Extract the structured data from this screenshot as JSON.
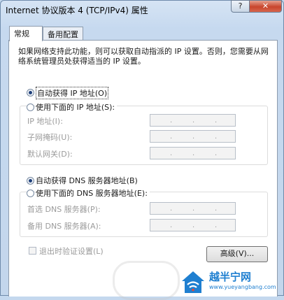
{
  "window": {
    "title": "Internet 协议版本 4 (TCP/IPv4) 属性",
    "help_label": "?",
    "close_label": "✕"
  },
  "tabs": [
    {
      "label": "常规",
      "active": true
    },
    {
      "label": "备用配置",
      "active": false
    }
  ],
  "description": "如果网络支持此功能，则可以获取自动指派的 IP 设置。否则，您需要从网络系统管理员处获得适当的 IP 设置。",
  "ip_section": {
    "auto_option": {
      "label": "自动获得 IP 地址(O)",
      "checked": true
    },
    "manual_option": {
      "label": "使用下面的 IP 地址(S):",
      "checked": false
    },
    "fields": [
      {
        "label": "IP 地址(I):",
        "value": ". . ."
      },
      {
        "label": "子网掩码(U):",
        "value": ". . ."
      },
      {
        "label": "默认网关(D):",
        "value": ". . ."
      }
    ]
  },
  "dns_section": {
    "auto_option": {
      "label": "自动获得 DNS 服务器地址(B)",
      "checked": true
    },
    "manual_option": {
      "label": "使用下面的 DNS 服务器地址(E):",
      "checked": false
    },
    "fields": [
      {
        "label": "首选 DNS 服务器(P):",
        "value": ". . ."
      },
      {
        "label": "备用 DNS 服务器(A):",
        "value": ". . ."
      }
    ]
  },
  "validate_on_exit": {
    "label": "退出时验证设置(L)",
    "checked": false
  },
  "advanced_button": "高级(V)...",
  "watermark": {
    "brand": "越半宁网",
    "url": "www.yueyangbang.com",
    "icon": "wifi-house-icon",
    "brand_color": "#1f7fd0"
  }
}
